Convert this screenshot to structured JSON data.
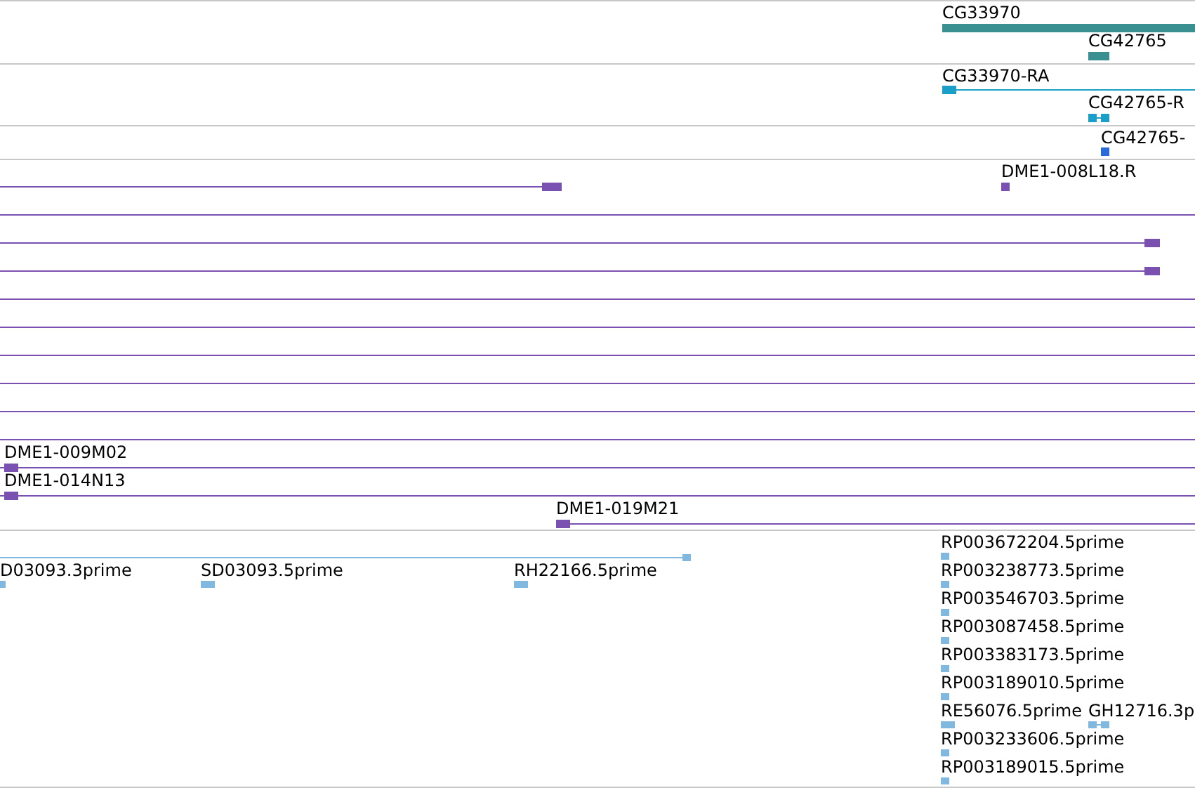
{
  "tracks": [
    {
      "features": [
        {
          "label": "CG33970",
          "kind": "gene"
        },
        {
          "label": "CG42765",
          "kind": "gene"
        }
      ]
    },
    {
      "features": [
        {
          "label": "CG33970-RA",
          "kind": "transcript"
        },
        {
          "label": "CG42765-R",
          "kind": "transcript"
        }
      ]
    },
    {
      "features": [
        {
          "label": "CG42765-",
          "kind": "cds"
        }
      ]
    },
    {
      "features": [
        {
          "kind": "clone"
        },
        {
          "label": "DME1-008L18.R",
          "kind": "clone"
        },
        {
          "kind": "clone"
        },
        {
          "kind": "clone"
        },
        {
          "kind": "clone"
        },
        {
          "kind": "clone"
        },
        {
          "kind": "clone"
        },
        {
          "kind": "clone"
        },
        {
          "kind": "clone"
        },
        {
          "kind": "clone"
        },
        {
          "kind": "clone"
        },
        {
          "label": "DME1-009M02",
          "kind": "clone"
        },
        {
          "label": "DME1-014N13",
          "kind": "clone"
        },
        {
          "label": "DME1-019M21",
          "kind": "clone"
        }
      ]
    },
    {
      "features": [
        {
          "kind": "est"
        },
        {
          "label": "RP003672204.5prime",
          "kind": "est"
        },
        {
          "label": "D03093.3prime",
          "kind": "est"
        },
        {
          "label": "SD03093.5prime",
          "kind": "est"
        },
        {
          "label": "RH22166.5prime",
          "kind": "est"
        },
        {
          "label": "RP003238773.5prime",
          "kind": "est"
        },
        {
          "label": "RP003546703.5prime",
          "kind": "est"
        },
        {
          "label": "RP003087458.5prime",
          "kind": "est"
        },
        {
          "label": "RP003383173.5prime",
          "kind": "est"
        },
        {
          "label": "RP003189010.5prime",
          "kind": "est"
        },
        {
          "label": "RE56076.5prime",
          "kind": "est"
        },
        {
          "label": "GH12716.3p",
          "kind": "est"
        },
        {
          "label": "RP003233606.5prime",
          "kind": "est"
        },
        {
          "label": "RP003189015.5prime",
          "kind": "est"
        }
      ]
    }
  ]
}
